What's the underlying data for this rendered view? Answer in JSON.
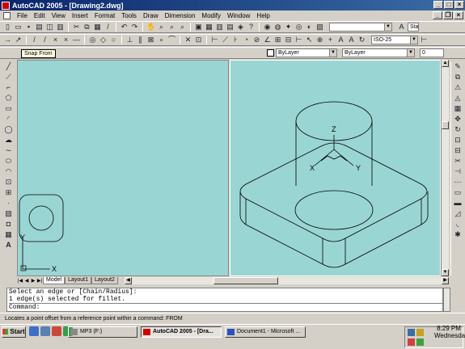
{
  "window": {
    "title": "AutoCAD 2005 - [Drawing2.dwg]"
  },
  "menu": [
    "File",
    "Edit",
    "View",
    "Insert",
    "Format",
    "Tools",
    "Draw",
    "Dimension",
    "Modify",
    "Window",
    "Help"
  ],
  "toolbar": {
    "dimstyle_value": "ISO-25",
    "textstyle_value": "Sta",
    "layer_linetype": "ByLayer",
    "layer_color": "ByLayer",
    "lineweight": "ByLayer",
    "lineweight_value": "0"
  },
  "tooltip": "Snap From",
  "drawing": {
    "ucs_y_label": "Y",
    "ucs_x_label": "X",
    "axis_z_label": "Z",
    "axis_x_label": "X",
    "axis_y_label": "Y"
  },
  "tabs": [
    "Model",
    "Layout1",
    "Layout2"
  ],
  "command": {
    "line1": "Select an edge or [Chain/Radius]:",
    "line2": "1 edge(s) selected for fillet.",
    "prompt": "Command:"
  },
  "status_text": "Locates a point offset from a reference point within a command:  FROM",
  "taskbar": {
    "start_label": "Start",
    "tasks": [
      "MP3 (F:)",
      "AutoCAD 2005 - [Dra...",
      "Document1 - Microsoft ..."
    ],
    "time": "8:29 PM",
    "day": "Wednesday"
  },
  "colors": {
    "viewport_bg": "#99d5d3",
    "titlebar": "#0a246a"
  }
}
